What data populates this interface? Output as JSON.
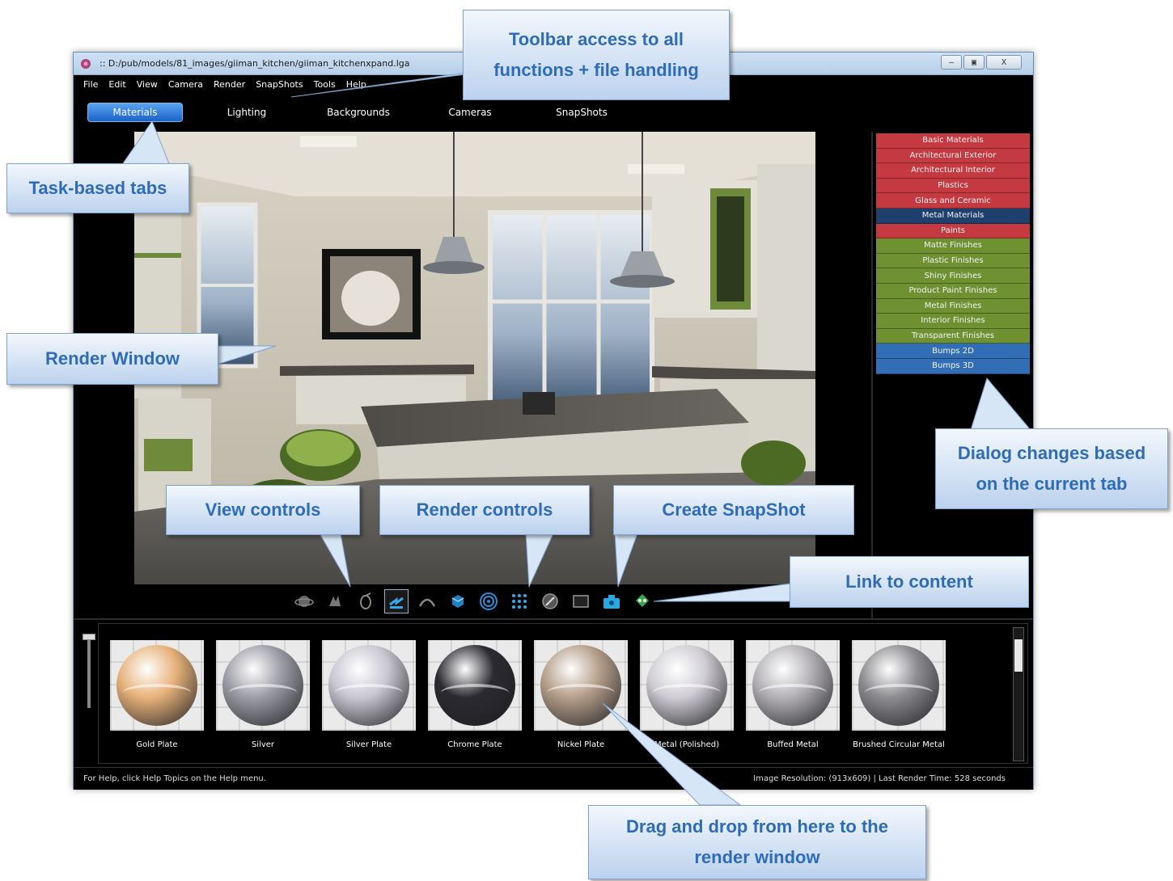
{
  "window": {
    "title": ":: D:/pub/models/81_images/giiman_kitchen/giiman_kitchenxpand.lga",
    "buttons": {
      "minimize": "—",
      "restore": "▣",
      "close": "X"
    }
  },
  "menu": [
    "File",
    "Edit",
    "View",
    "Camera",
    "Render",
    "SnapShots",
    "Tools",
    "Help"
  ],
  "tabs": [
    "Materials",
    "Lighting",
    "Backgrounds",
    "Cameras",
    "SnapShots"
  ],
  "active_tab": "Materials",
  "categories": [
    {
      "label": "Basic Materials",
      "color": "#c53a41"
    },
    {
      "label": "Architectural Exterior",
      "color": "#c53a41"
    },
    {
      "label": "Architectural Interior",
      "color": "#c53a41"
    },
    {
      "label": "Plastics",
      "color": "#c53a41"
    },
    {
      "label": "Glass and Ceramic",
      "color": "#c53a41"
    },
    {
      "label": "Metal Materials",
      "color": "#1f3f6d"
    },
    {
      "label": "Paints",
      "color": "#c53a41"
    },
    {
      "label": "Matte Finishes",
      "color": "#6f9131"
    },
    {
      "label": "Plastic Finishes",
      "color": "#6f9131"
    },
    {
      "label": "Shiny Finishes",
      "color": "#6f9131"
    },
    {
      "label": "Product Paint Finishes",
      "color": "#6f9131"
    },
    {
      "label": "Metal Finishes",
      "color": "#6f9131"
    },
    {
      "label": "Interior Finishes",
      "color": "#6f9131"
    },
    {
      "label": "Transparent Finishes",
      "color": "#6f9131"
    },
    {
      "label": "Bumps 2D",
      "color": "#326eb6"
    },
    {
      "label": "Bumps 3D",
      "color": "#326eb6"
    }
  ],
  "toolbar_icons": [
    "orbit-icon",
    "pan-icon",
    "zoom-icon",
    "select-icon",
    "arc-icon",
    "cube-icon",
    "target-icon",
    "grid-icon",
    "compass-icon",
    "frame-icon",
    "snapshot-icon",
    "link-icon"
  ],
  "materials": [
    {
      "label": "Gold Plate",
      "tone": "#e7b27a"
    },
    {
      "label": "Silver",
      "tone": "#9c9ca6"
    },
    {
      "label": "Silver Plate",
      "tone": "#c9c7d0"
    },
    {
      "label": "Chrome Plate",
      "tone": "#2a2a30"
    },
    {
      "label": "Nickel Plate",
      "tone": "#b59e8a"
    },
    {
      "label": "Metal (Polished)",
      "tone": "#cfcdd3"
    },
    {
      "label": "Buffed Metal",
      "tone": "#b3b1b5"
    },
    {
      "label": "Brushed Circular Metal",
      "tone": "#8c8c90"
    }
  ],
  "status": {
    "help": "For Help, click Help Topics on the Help menu.",
    "info": "Image Resolution: (913x609)  |  Last Render Time: 528 seconds"
  },
  "callouts": {
    "toolbar": [
      "Toolbar access to all",
      "functions + file handling"
    ],
    "tabs": [
      "Task-based tabs"
    ],
    "render_window": [
      "Render Window"
    ],
    "dialog": [
      "Dialog changes based",
      "on the current tab"
    ],
    "view_controls": [
      "View controls"
    ],
    "render_controls": [
      "Render controls"
    ],
    "create_snapshot": [
      "Create SnapShot"
    ],
    "link_content": [
      "Link to content"
    ],
    "drag_drop": [
      "Drag and drop from here to the",
      "render window"
    ]
  }
}
